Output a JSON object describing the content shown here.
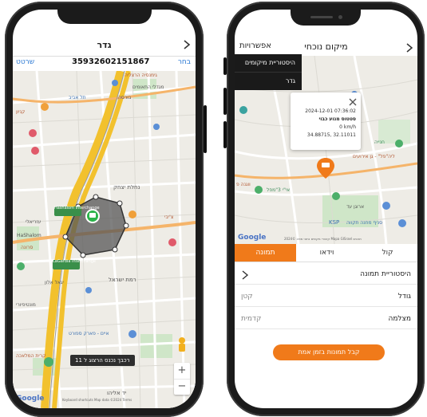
{
  "left_phone": {
    "header": {
      "title": "גדר",
      "back_icon": "chevron-right-icon"
    },
    "device_bar": {
      "share_label": "שרטט",
      "device_id": "35932602151867",
      "select_label": "בחר"
    },
    "map": {
      "labels": {
        "l1": "גימנסיה הרצליה",
        "l2": "מגדלי התאומים",
        "l3": "בורסה",
        "l4": "Hashalom Interchange",
        "l5": "נחלת יצחק",
        "l6": "רמת ישראל",
        "l7": "HaShalom",
        "l8": "LaGardia Interchange",
        "l9": "עזריאלי",
        "l10": "סרונה",
        "l11": "יגאל אלון",
        "l12": "איים - פארק ספורט",
        "l13": "מונטיפיורי",
        "l14": "יד אליהו",
        "l15": "קרית המלאכה",
        "l16": "צ'יבי",
        "l17": "תל אביב",
        "l18": "קניון"
      },
      "tooltip": "רכבך נכנס הרצוג ל 11",
      "zoom_in": "+",
      "zoom_out": "−",
      "google_logo": "Google",
      "attribution": "Keyboard shortcuts  Map data ©2024  Terms"
    }
  },
  "right_phone": {
    "header": {
      "title": "מיקום נוכחי",
      "options_label": "אפשרויות",
      "back_icon": "chevron-right-icon"
    },
    "options_menu": {
      "items": [
        "היסטוריית מיקומים",
        "גדר"
      ]
    },
    "info_popup": {
      "timestamp": "2024-12-01 07:36:02",
      "status": "סטטוס מנוע כבוי",
      "speed": "0 km/h",
      "coords": "34.88715, 32.11011",
      "close_icon": "close-icon"
    },
    "map": {
      "labels": {
        "r1": "חנייה",
        "r2": "ליה\"פל\" - גן אירועים",
        "r3": "אי\"י 3\"מפל",
        "r4": "ארוגן עד",
        "r5": "KSP",
        "r6": "סניף מחנה תקווה",
        "r7": "ווגנה פ"
      },
      "google_logo": "Google",
      "attribution": "קיצורי מקשים  נתוני מפה ©2024  Mapa GISrael  תנאים"
    },
    "tabs": [
      {
        "label": "קול",
        "active": false
      },
      {
        "label": "וידאו",
        "active": false
      },
      {
        "label": "תמונה",
        "active": true
      }
    ],
    "list": {
      "history": "היסטוריית תמונה",
      "size_label": "גודל",
      "size_value": "קטן",
      "camera_label": "מצלמה",
      "camera_value": "קדמית"
    },
    "cta_button": "קבל תמונות בזמן אמת",
    "accent_color": "#f07a1a"
  }
}
